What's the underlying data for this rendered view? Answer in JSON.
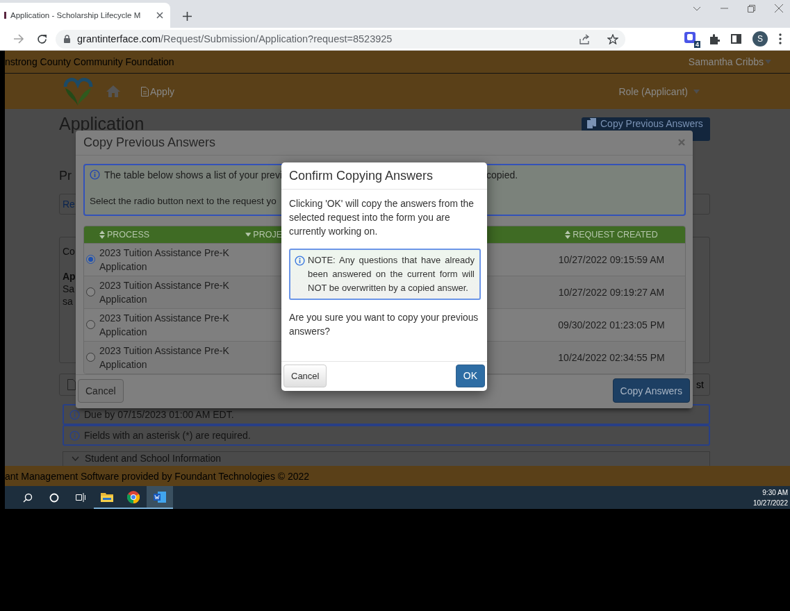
{
  "browser": {
    "tab_title": "Application - Scholarship Lifecycle M",
    "url_host": "grantinterface.com",
    "url_path": "/Request/Submission/Application?request=8523925",
    "extension_badge": "4",
    "profile_initial": "S"
  },
  "site_header": {
    "org_name": "nstrong County Community Foundation",
    "user_menu": "Samantha Cribbs",
    "nav": [
      {
        "label": "Apply"
      }
    ],
    "role_menu": "Role (Applicant)"
  },
  "page": {
    "title": "Application",
    "copy_button": "Copy Previous Answers",
    "subtitle_fragment": "Pr",
    "link_fragment": "Re",
    "card_fragments": [
      "Co",
      "Ap",
      "Sa",
      "sa"
    ],
    "button_fragment": "st"
  },
  "notices": [
    "Due by 07/15/2023 01:00 AM EDT.",
    "Fields with an asterisk (*) are required."
  ],
  "section": "Student and School Information",
  "footer": "ant Management Software provided by Foundant Technologies © 2022",
  "copy_dialog": {
    "title": "Copy Previous Answers",
    "info_line_1": "The table below shows a list of your previ",
    "info_line_1_end": "copied.",
    "info_line_2": "Select the radio button next to the request yo",
    "columns": [
      {
        "label": "PROCESS",
        "kind": "sortable"
      },
      {
        "label": "PROJE",
        "kind": "sorted"
      },
      {
        "label": "REQUEST CREATED",
        "kind": "sortable"
      }
    ],
    "rows": [
      {
        "process": "2023 Tuition Assistance Pre-K Application",
        "created": "10/27/2022 09:15:59 AM",
        "selected": true
      },
      {
        "process": "2023 Tuition Assistance Pre-K Application",
        "created": "10/27/2022 09:19:27 AM",
        "selected": false
      },
      {
        "process": "2023 Tuition Assistance Pre-K Application",
        "created": "09/30/2022 01:23:05 PM",
        "selected": false
      },
      {
        "process": "2023 Tuition Assistance Pre-K Application",
        "created": "10/24/2022 02:34:55 PM",
        "selected": false
      }
    ],
    "cancel": "Cancel",
    "confirm": "Copy Answers"
  },
  "confirm_dialog": {
    "title": "Confirm Copying Answers",
    "message": "Clicking 'OK' will copy the answers from the selected request into the form you are currently working on.",
    "note": "NOTE: Any questions that have already been answered on the current form will NOT be overwritten by a copied answer.",
    "question": "Are you sure you want to copy your previous answers?",
    "cancel": "Cancel",
    "ok": "OK"
  },
  "taskbar": {
    "apps": [
      {
        "kind": "explorer",
        "selected": false
      },
      {
        "kind": "chrome",
        "selected": false
      },
      {
        "kind": "word",
        "selected": true
      }
    ],
    "time": "9:30 AM",
    "date": "10/27/2022"
  }
}
